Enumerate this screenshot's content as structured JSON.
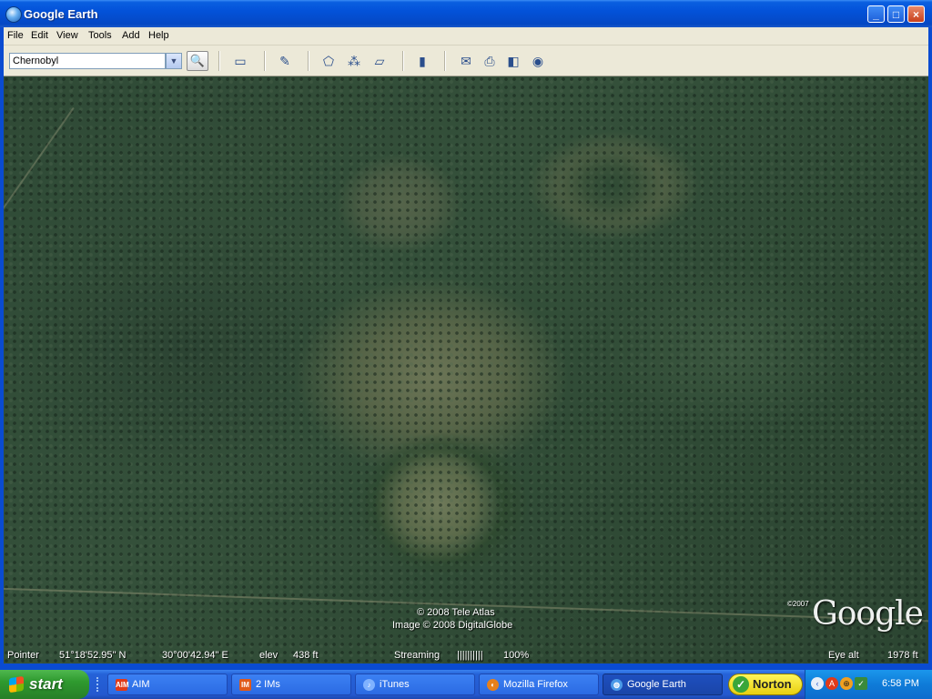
{
  "window": {
    "title": "Google Earth",
    "controls": {
      "minimize": "_",
      "maximize": "□",
      "close": "×"
    }
  },
  "menu": [
    "File",
    "Edit",
    "View",
    "Tools",
    "Add",
    "Help"
  ],
  "search": {
    "value": "Chernobyl",
    "button_icon": "magnifier-icon"
  },
  "toolbar_icons": [
    "sidebar-toggle-icon",
    "placemark-add-icon",
    "polygon-add-icon",
    "path-add-icon",
    "image-overlay-icon",
    "ruler-icon",
    "email-icon",
    "print-icon",
    "google-maps-icon",
    "sky-icon"
  ],
  "map": {
    "copyright_1": "© 2008 Tele Atlas",
    "copyright_2": "Image © 2008 DigitalGlobe",
    "copyright_year": "©2007",
    "logo": "Google"
  },
  "status": {
    "pointer_label": "Pointer",
    "latitude": "51°18'52.95\" N",
    "longitude": "30°00'42.94\" E",
    "elev_label": "elev",
    "elev_value": "438 ft",
    "streaming_label": "Streaming",
    "streaming_bar": "||||||||||",
    "streaming_pct": "100%",
    "eye_alt_label": "Eye alt",
    "eye_alt_value": "1978 ft"
  },
  "taskbar": {
    "start": "start",
    "tasks": [
      {
        "label": "AIM",
        "icon": "aim-icon",
        "color": "#e03a1a"
      },
      {
        "label": "2 IMs",
        "icon": "im-icon",
        "color": "#e05a1a"
      },
      {
        "label": "iTunes",
        "icon": "itunes-icon",
        "color": "#7fb2ff"
      },
      {
        "label": "Mozilla Firefox",
        "icon": "firefox-icon",
        "color": "#e8801a"
      },
      {
        "label": "Google Earth",
        "icon": "google-earth-icon",
        "color": "#4a9ae8"
      }
    ],
    "norton": "Norton",
    "clock": "6:58 PM"
  }
}
